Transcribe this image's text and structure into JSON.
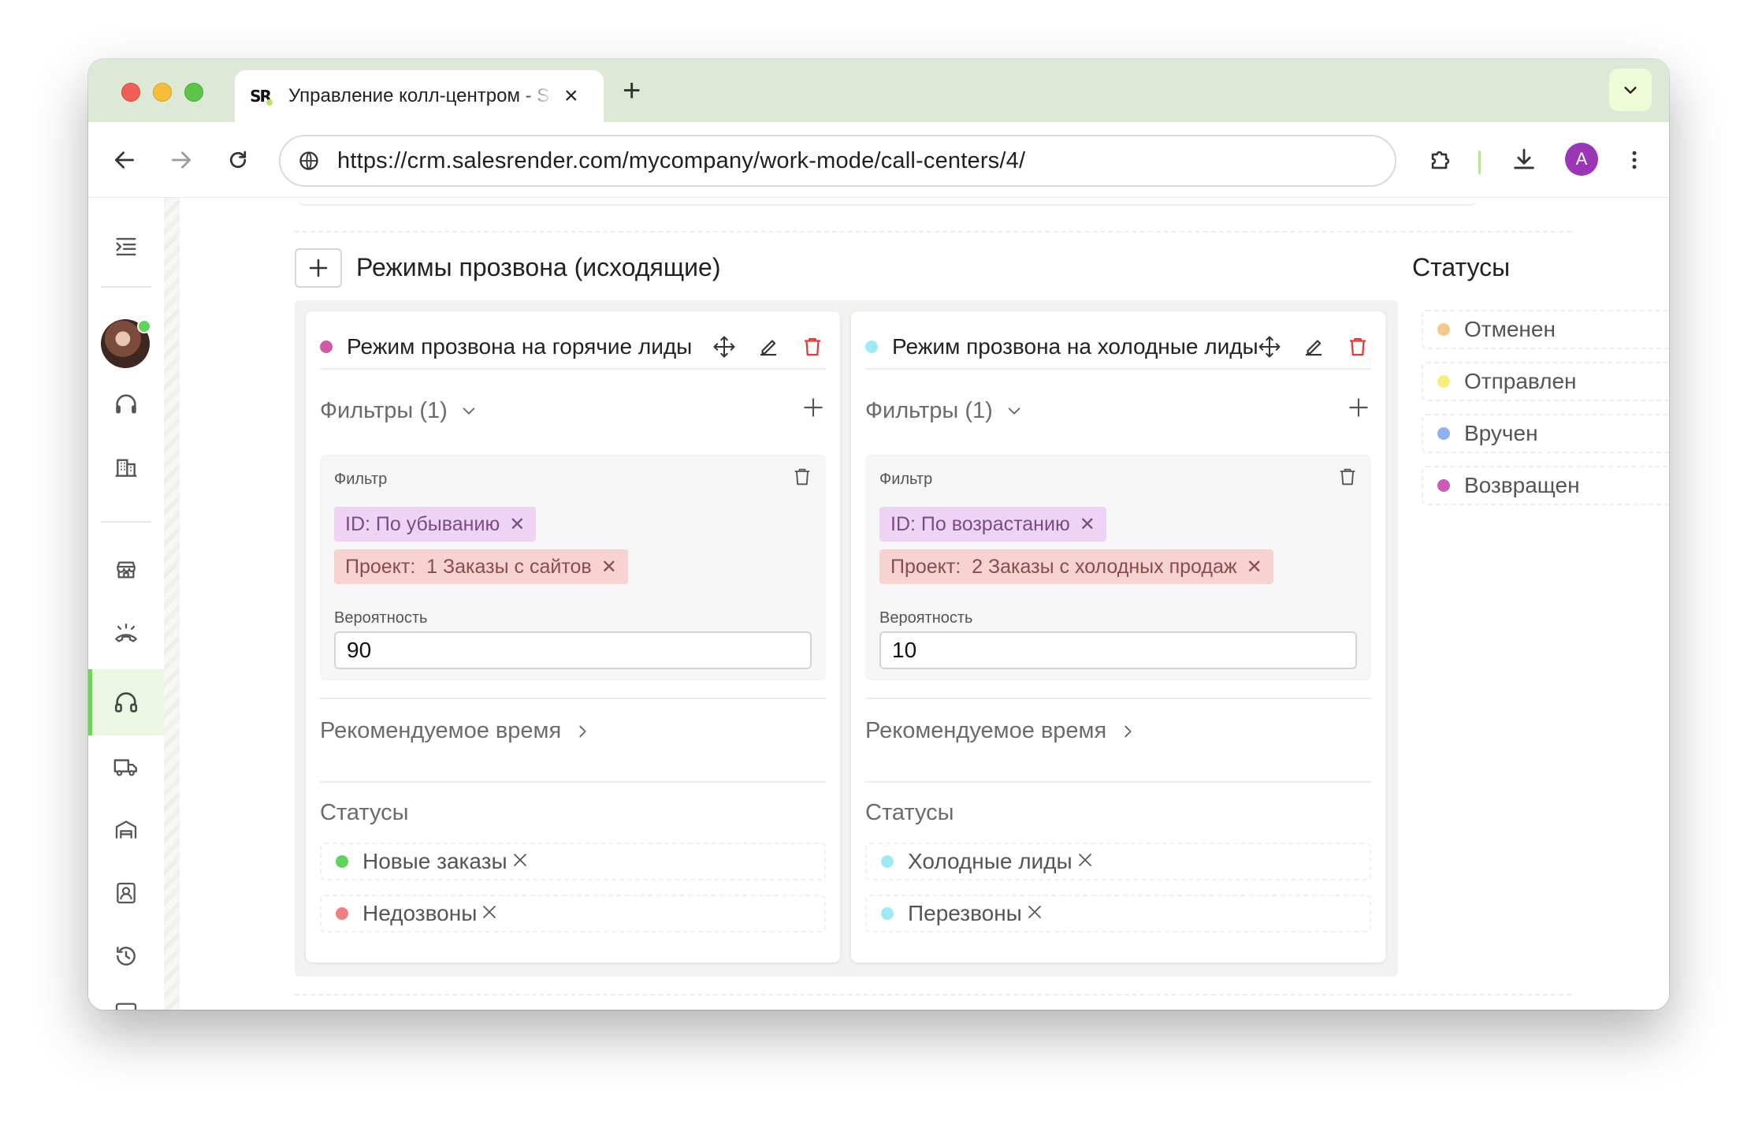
{
  "browser": {
    "tab_title": "Управление колл-центром - SalesRender",
    "favicon_text": "SR",
    "url": "https://crm.salesrender.com/mycompany/work-mode/call-centers/4/",
    "profile_letter": "A"
  },
  "page": {
    "section_title": "Режимы прозвона (исходящие)",
    "right_panel_title": "Статусы",
    "right_statuses": [
      {
        "label": "Отменен",
        "color": "#f5c88e"
      },
      {
        "label": "Отправлен",
        "color": "#f7ef7c"
      },
      {
        "label": "Вручен",
        "color": "#8fb1f3"
      },
      {
        "label": "Возвращен",
        "color": "#c95bb6"
      }
    ]
  },
  "modes": [
    {
      "name": "Режим прозвона на горячие лиды",
      "dot_color": "#d05aa8",
      "filters_label": "Фильтры (1)",
      "filter_label": "Фильтр",
      "chip_sort": "ID: По убыванию",
      "chip_project": "Проект:  1 Заказы с сайтов",
      "probability_label": "Вероятность",
      "probability_value": "90",
      "recommended_time_label": "Рекомендуемое время",
      "statuses_label": "Статусы",
      "statuses": [
        {
          "label": "Новые заказы",
          "color": "#5fd35a"
        },
        {
          "label": "Недозвоны",
          "color": "#f08080"
        }
      ]
    },
    {
      "name": "Режим прозвона на холодные лиды",
      "dot_color": "#9fe9f4",
      "filters_label": "Фильтры (1)",
      "filter_label": "Фильтр",
      "chip_sort": "ID: По возрастанию",
      "chip_project": "Проект:  2 Заказы с холодных продаж",
      "probability_label": "Вероятность",
      "probability_value": "10",
      "recommended_time_label": "Рекомендуемое время",
      "statuses_label": "Статусы",
      "statuses": [
        {
          "label": "Холодные лиды",
          "color": "#9fe9f4"
        },
        {
          "label": "Перезвоны",
          "color": "#9fe9f4"
        }
      ]
    }
  ],
  "colors": {
    "delete_red": "#e53935",
    "active_green": "#6fd25d",
    "chip_purple_bg": "#efd3f5",
    "chip_red_bg": "#f6d2d0"
  }
}
